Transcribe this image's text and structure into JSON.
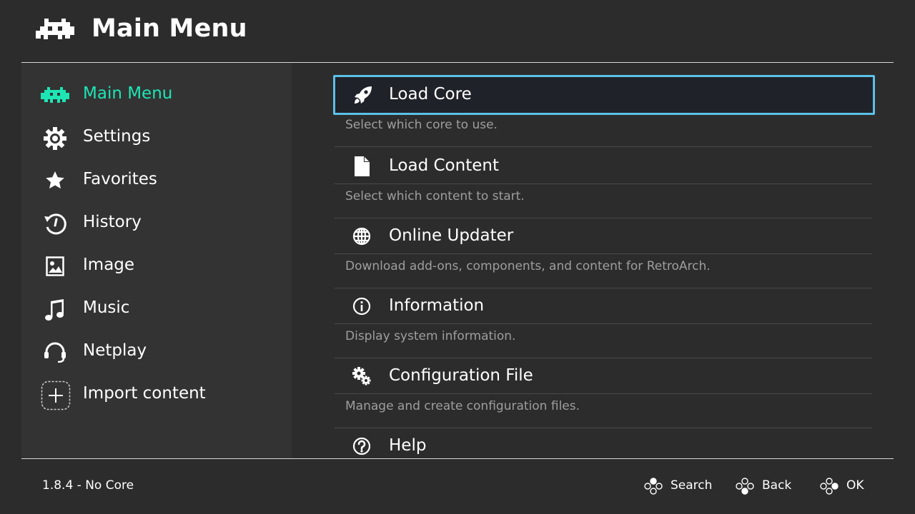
{
  "header": {
    "title": "Main Menu"
  },
  "sidebar": {
    "items": [
      {
        "label": "Main Menu",
        "icon": "retroarch-invader-icon",
        "active": true
      },
      {
        "label": "Settings",
        "icon": "gear-icon"
      },
      {
        "label": "Favorites",
        "icon": "star-icon"
      },
      {
        "label": "History",
        "icon": "history-clock-icon"
      },
      {
        "label": "Image",
        "icon": "image-icon"
      },
      {
        "label": "Music",
        "icon": "music-note-icon"
      },
      {
        "label": "Netplay",
        "icon": "headset-icon"
      },
      {
        "label": "Import content",
        "icon": "add-plus-icon"
      }
    ]
  },
  "menu": {
    "entries": [
      {
        "label": "Load Core",
        "desc": "Select which core to use.",
        "icon": "rocket-icon",
        "selected": true
      },
      {
        "label": "Load Content",
        "desc": "Select which content to start.",
        "icon": "file-icon"
      },
      {
        "label": "Online Updater",
        "desc": "Download add-ons, components, and content for RetroArch.",
        "icon": "globe-icon"
      },
      {
        "label": "Information",
        "desc": "Display system information.",
        "icon": "info-icon"
      },
      {
        "label": "Configuration File",
        "desc": "Manage and create configuration files.",
        "icon": "gears-icon"
      },
      {
        "label": "Help",
        "desc": "",
        "icon": "help-icon"
      }
    ]
  },
  "footer": {
    "version": "1.8.4 - No Core",
    "search_label": "Search",
    "back_label": "Back",
    "ok_label": "OK"
  },
  "colors": {
    "background": "#2c2c2c",
    "sidebar": "#333333",
    "accent_active": "#1ee5b4",
    "selection_border": "#5cc0e6",
    "description": "#9e9e9e"
  }
}
